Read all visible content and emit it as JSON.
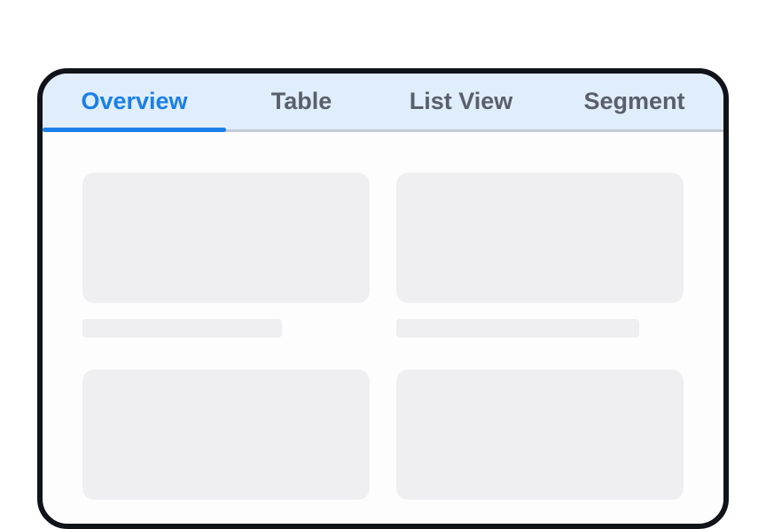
{
  "tabs": [
    {
      "label": "Overview",
      "active": true
    },
    {
      "label": "Table",
      "active": false
    },
    {
      "label": "List View",
      "active": false
    },
    {
      "label": "Segment",
      "active": false
    }
  ],
  "colors": {
    "accent": "#1a7fe8",
    "tab_inactive": "#59606b",
    "tabbar_bg": "#e0edfb",
    "skeleton": "#efeff1",
    "frame": "#11131a"
  }
}
